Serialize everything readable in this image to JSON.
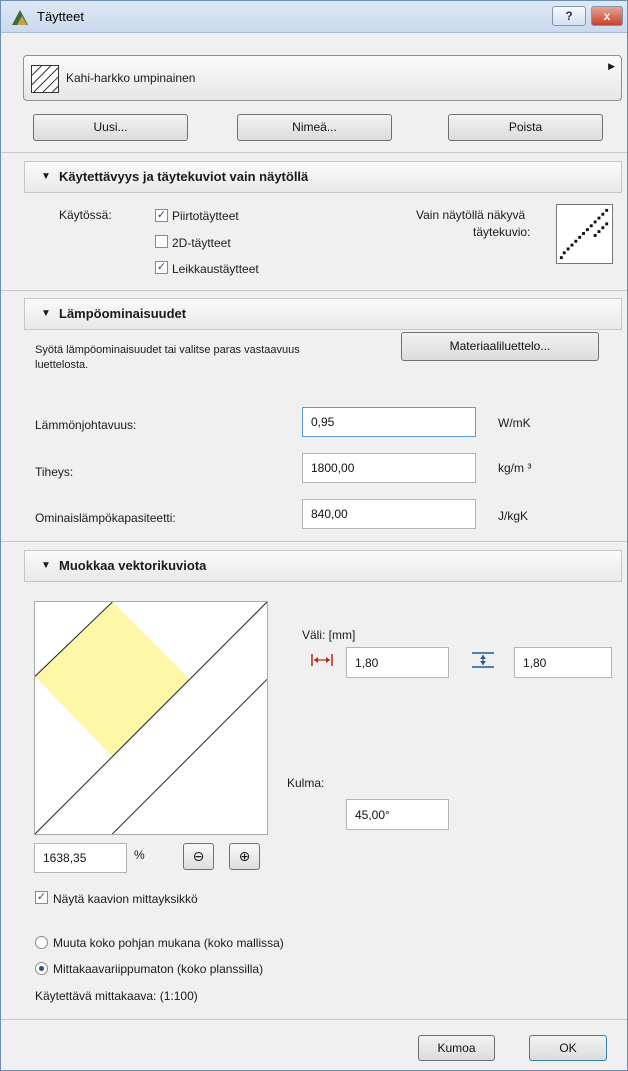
{
  "window": {
    "title": "Täytteet",
    "help": "?",
    "close": "x"
  },
  "fill": {
    "name": "Kahi-harkko umpinainen"
  },
  "buttons": {
    "new": "Uusi...",
    "rename": "Nimeä...",
    "delete": "Poista"
  },
  "usage": {
    "header": "Käytettävyys ja täytekuviot vain näytöllä",
    "in_use_label": "Käytössä:",
    "options": [
      {
        "label": "Piirtotäytteet",
        "checked": true
      },
      {
        "label": "2D-täytteet",
        "checked": false
      },
      {
        "label": "Leikkaustäytteet",
        "checked": true
      }
    ],
    "screen_only_label_1": "Vain näytöllä näkyvä",
    "screen_only_label_2": "täytekuvio:"
  },
  "thermal": {
    "header": "Lämpöominaisuudet",
    "hint_line1": "Syötä lämpöominaisuudet tai valitse paras vastaavuus",
    "hint_line2": "luettelosta.",
    "material_button": "Materiaaliluettelo...",
    "rows": [
      {
        "label": "Lämmönjohtavuus:",
        "value": "0,95",
        "unit": "W/mK"
      },
      {
        "label": "Tiheys:",
        "value": "1800,00",
        "unit": "kg/m ³"
      },
      {
        "label": "Ominaislämpökapasiteetti:",
        "value": "840,00",
        "unit": "J/kgK"
      }
    ]
  },
  "vector": {
    "header": "Muokkaa vektorikuviota",
    "spacing_label": "Väli: [mm]",
    "spacing_h": "1,80",
    "spacing_v": "1,80",
    "angle_label": "Kulma:",
    "angle": "45,00°",
    "zoom_value": "1638,35",
    "zoom_unit": "%",
    "zoom_out": "⊖",
    "zoom_in": "⊕",
    "show_unit_label": "Näytä kaavion mittayksikkö",
    "show_unit_checked": true,
    "radio_model": "Muuta koko pohjan mukana (koko mallissa)",
    "radio_sheet": "Mittakaavariippumaton (koko planssilla)",
    "selected_radio": "sheet",
    "scale_text": "Käytettävä mittakaava: (1:100)"
  },
  "footer": {
    "cancel": "Kumoa",
    "ok": "OK"
  },
  "colors": {
    "preview_fill": "#fdf7a7",
    "accent": "#2b4f83",
    "close": "#c4432b"
  }
}
